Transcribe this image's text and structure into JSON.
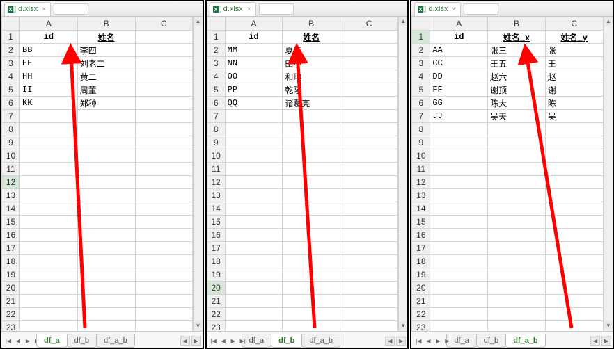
{
  "file_name": "d.xlsx",
  "panels": [
    {
      "columns": [
        "A",
        "B",
        "C"
      ],
      "header_row": {
        "A": "id",
        "B": "姓名",
        "C": ""
      },
      "data_rows": [
        {
          "A": "BB",
          "B": "李四",
          "C": ""
        },
        {
          "A": "EE",
          "B": "刘老二",
          "C": ""
        },
        {
          "A": "HH",
          "B": "黄二",
          "C": ""
        },
        {
          "A": "II",
          "B": "周董",
          "C": ""
        },
        {
          "A": "KK",
          "B": "郑种",
          "C": ""
        }
      ],
      "visible_row_numbers": [
        1,
        2,
        3,
        4,
        5,
        6,
        7,
        8,
        9,
        10,
        11,
        12,
        13,
        14,
        15,
        16,
        17,
        18,
        19,
        20,
        21,
        22,
        23
      ],
      "selected_row": 12,
      "sheet_tabs": [
        "df_a",
        "df_b",
        "df_a_b"
      ],
      "active_tab": "df_a"
    },
    {
      "columns": [
        "A",
        "B",
        "C"
      ],
      "header_row": {
        "A": "id",
        "B": "姓名",
        "C": ""
      },
      "data_rows": [
        {
          "A": "MM",
          "B": "夏天",
          "C": ""
        },
        {
          "A": "NN",
          "B": "田小",
          "C": ""
        },
        {
          "A": "OO",
          "B": "和珅",
          "C": ""
        },
        {
          "A": "PP",
          "B": "乾隆",
          "C": ""
        },
        {
          "A": "QQ",
          "B": "诸葛亮",
          "C": ""
        }
      ],
      "visible_row_numbers": [
        1,
        2,
        3,
        4,
        5,
        6,
        7,
        8,
        9,
        10,
        11,
        12,
        13,
        14,
        15,
        16,
        17,
        18,
        19,
        20,
        21,
        22,
        23
      ],
      "selected_row": 20,
      "sheet_tabs": [
        "df_a",
        "df_b",
        "df_a_b"
      ],
      "active_tab": "df_b"
    },
    {
      "columns": [
        "A",
        "B",
        "C"
      ],
      "header_row": {
        "A": "id",
        "B": "姓名_x",
        "C": "姓名_y"
      },
      "data_rows": [
        {
          "A": "AA",
          "B": "张三",
          "C": "张"
        },
        {
          "A": "CC",
          "B": "王五",
          "C": "王"
        },
        {
          "A": "DD",
          "B": "赵六",
          "C": "赵"
        },
        {
          "A": "FF",
          "B": "谢顶",
          "C": "谢"
        },
        {
          "A": "GG",
          "B": "陈大",
          "C": "陈"
        },
        {
          "A": "JJ",
          "B": "吴天",
          "C": "吴"
        }
      ],
      "visible_row_numbers": [
        1,
        2,
        3,
        4,
        5,
        6,
        7,
        8,
        9,
        10,
        11,
        12,
        13,
        14,
        15,
        16,
        17,
        18,
        19,
        20,
        21,
        22,
        23
      ],
      "selected_row": 1,
      "sheet_tabs": [
        "df_a",
        "df_b",
        "df_a_b"
      ],
      "active_tab": "df_a_b"
    }
  ],
  "arrow_color": "#ff0000"
}
